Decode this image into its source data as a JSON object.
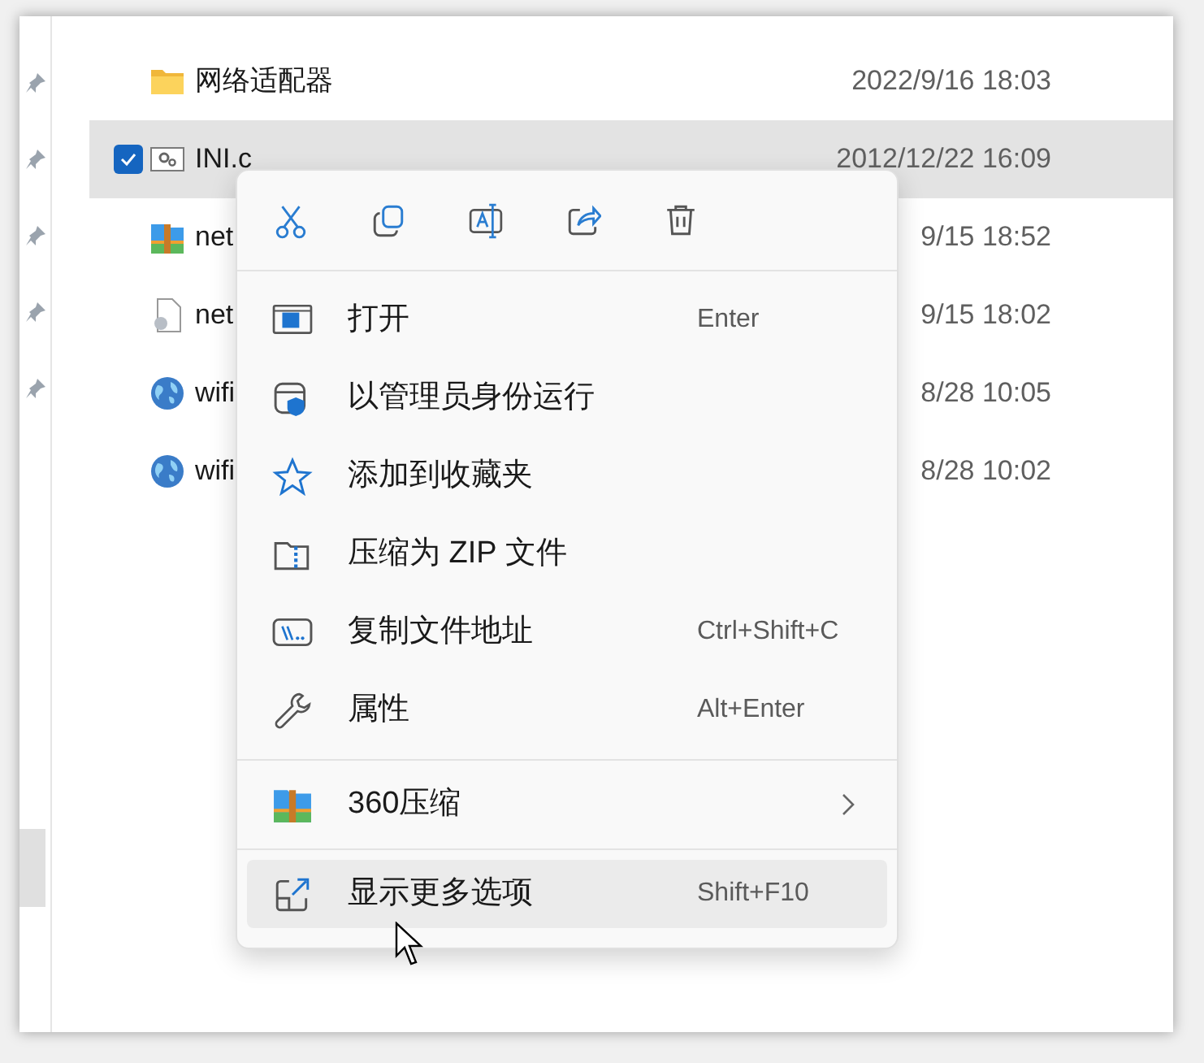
{
  "files": [
    {
      "kind": "folder",
      "name": "网络适配器",
      "date": "2022/9/16 18:03",
      "selected": false
    },
    {
      "kind": "settings",
      "name": "INI.c",
      "date": "2012/12/22 16:09",
      "selected": true
    },
    {
      "kind": "archive",
      "name": "net",
      "date": "9/15 18:52",
      "selected": false
    },
    {
      "kind": "document",
      "name": "net",
      "date": "9/15 18:02",
      "selected": false
    },
    {
      "kind": "globe",
      "name": "wifi",
      "date": "8/28 10:05",
      "selected": false
    },
    {
      "kind": "globe",
      "name": "wifi",
      "date": "8/28 10:02",
      "selected": false
    }
  ],
  "context_menu": {
    "toolbar": [
      {
        "kind": "cut"
      },
      {
        "kind": "copy"
      },
      {
        "kind": "rename"
      },
      {
        "kind": "share"
      },
      {
        "kind": "delete"
      }
    ],
    "groups": [
      [
        {
          "kind": "open",
          "label": "打开",
          "shortcut": "Enter",
          "hovered": false
        },
        {
          "kind": "admin",
          "label": "以管理员身份运行",
          "hovered": false
        },
        {
          "kind": "star",
          "label": "添加到收藏夹",
          "hovered": false
        },
        {
          "kind": "zip",
          "label": "压缩为 ZIP 文件",
          "hovered": false
        },
        {
          "kind": "path",
          "label": "复制文件地址",
          "shortcut": "Ctrl+Shift+C",
          "hovered": false
        },
        {
          "kind": "wrench",
          "label": "属性",
          "shortcut": "Alt+Enter",
          "hovered": false
        }
      ],
      [
        {
          "kind": "archive",
          "label": "360压缩",
          "submenu": true,
          "hovered": false
        }
      ],
      [
        {
          "kind": "more",
          "label": "显示更多选项",
          "shortcut": "Shift+F10",
          "hovered": true
        }
      ]
    ]
  }
}
